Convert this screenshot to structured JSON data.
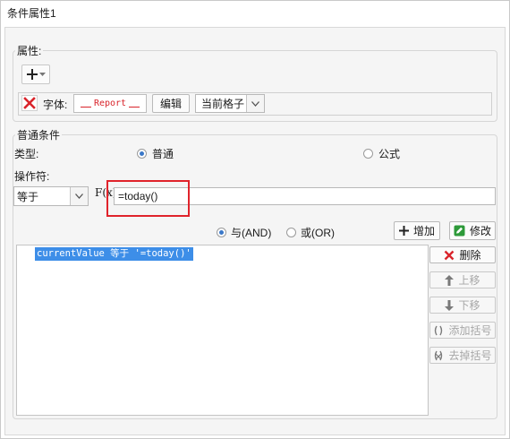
{
  "window": {
    "title": "条件属性1"
  },
  "attributes": {
    "legend": "属性:",
    "font_label": "字体:",
    "font_preview": "Report",
    "edit_button": "编辑",
    "scope_value": "当前格子"
  },
  "condition": {
    "legend": "普通条件",
    "type_label": "类型:",
    "type_normal": "普通",
    "type_formula": "公式",
    "operator_label": "操作符:",
    "operator_value": "等于",
    "formula_icon_text": "F(x)",
    "value_input": "=today()"
  },
  "logic": {
    "and_label": "与(AND)",
    "or_label": "或(OR)",
    "add_button": "增加",
    "modify_button": "修改"
  },
  "conditions_list": [
    "currentValue 等于 '=today()'"
  ],
  "side_buttons": {
    "delete": "删除",
    "move_up": "上移",
    "move_down": "下移",
    "add_paren": "添加括号",
    "remove_paren": "去掉括号"
  },
  "colors": {
    "accent_red": "#d9242b",
    "selection_blue": "#3d8ee8",
    "modify_green": "#2e9a3a"
  }
}
